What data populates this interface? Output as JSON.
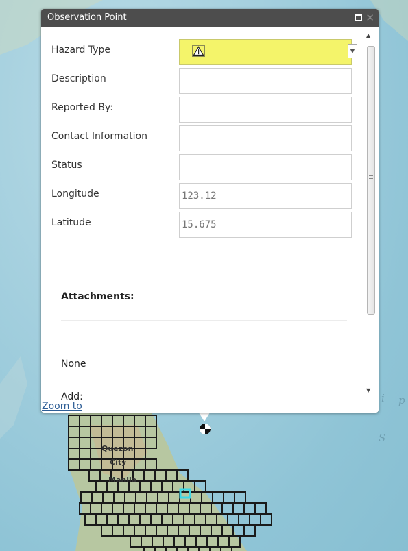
{
  "popup": {
    "title": "Observation Point",
    "fields": [
      {
        "label": "Hazard Type",
        "value": ""
      },
      {
        "label": "Description",
        "value": ""
      },
      {
        "label": "Reported By:",
        "value": ""
      },
      {
        "label": "Contact Information",
        "value": ""
      },
      {
        "label": "Status",
        "value": ""
      },
      {
        "label": "Longitude",
        "value": "123.12"
      },
      {
        "label": "Latitude",
        "value": "15.675"
      }
    ],
    "attachments": {
      "title": "Attachments:",
      "none_text": "None",
      "add_label": "Add:"
    },
    "zoom_link": "Zoom to",
    "icons": {
      "warning": "warning-triangle-icon",
      "dropdown": "chevron-down-icon",
      "maximize": "maximize-icon",
      "close": "close-icon"
    }
  },
  "map": {
    "labels": [
      "i",
      "p",
      "S"
    ],
    "city_labels": [
      "Quezon",
      "City",
      "Manila"
    ]
  },
  "colors": {
    "header_bg": "#4d4d4d",
    "required_field_bg": "#f4f46a",
    "link": "#2d5d95",
    "highlight_cell": "#3ad8e8",
    "water": "#a3cfde"
  }
}
